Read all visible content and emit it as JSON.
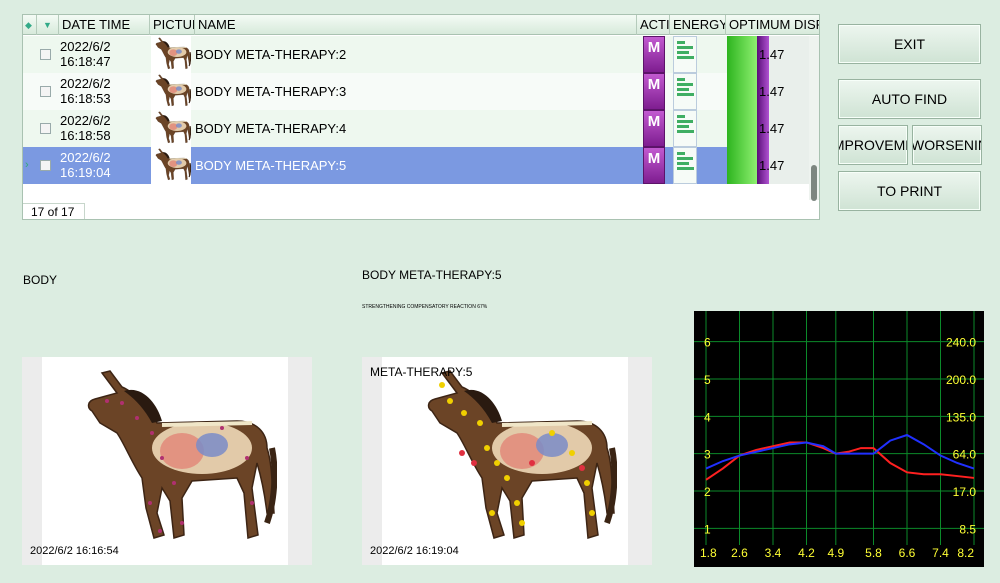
{
  "grid": {
    "headers": [
      "DATE TIME",
      "PICTUR",
      "NAME",
      "ACTIV",
      "ENERGY",
      "OPTIMUM DISPE"
    ],
    "rows": [
      {
        "date": "2022/6/2",
        "time": "16:18:47",
        "name": "BODY META-THERAPY:2",
        "badge": "M",
        "value": "1.47",
        "selected": false
      },
      {
        "date": "2022/6/2",
        "time": "16:18:53",
        "name": "BODY META-THERAPY:3",
        "badge": "M",
        "value": "1.47",
        "selected": false
      },
      {
        "date": "2022/6/2",
        "time": "16:18:58",
        "name": "BODY META-THERAPY:4",
        "badge": "M",
        "value": "1.47",
        "selected": false
      },
      {
        "date": "2022/6/2",
        "time": "16:19:04",
        "name": "BODY META-THERAPY:5",
        "badge": "M",
        "value": "1.47",
        "selected": true
      }
    ],
    "count": "17 of 17",
    "current_indicator": "›"
  },
  "buttons": {
    "exit": "EXIT",
    "auto_find": "AUTO FIND",
    "improvement": "IMPROVEMENT",
    "worsening": "WORSENING",
    "print": "TO PRINT"
  },
  "left_panel": {
    "label": "BODY",
    "timestamp": "2022/6/2 16:16:54"
  },
  "right_panel": {
    "title": "BODY META-THERAPY:5",
    "subtitle": "STRENGTHENING COMPENSATORY REACTION 67%",
    "caption": "META-THERAPY:5",
    "timestamp": "2022/6/2 16:19:04"
  },
  "chart_data": {
    "type": "line",
    "x_ticks": [
      "1.8",
      "2.6",
      "3.4",
      "4.2",
      "4.9",
      "5.8",
      "6.6",
      "7.4",
      "8.2"
    ],
    "left_ticks": [
      "6",
      "5",
      "4",
      "3",
      "2",
      "1"
    ],
    "right_ticks": [
      "240.0",
      "200.0",
      "135.0",
      "64.0",
      "17.0",
      "8.5"
    ],
    "ylim": [
      0.5,
      6.5
    ],
    "series": [
      {
        "color": "#ff2020",
        "x": [
          1.8,
          2.2,
          2.6,
          3.0,
          3.4,
          3.8,
          4.2,
          4.6,
          4.9,
          5.2,
          5.5,
          5.8,
          6.2,
          6.6,
          7.0,
          7.4,
          7.8,
          8.2
        ],
        "y": [
          2.3,
          2.6,
          2.95,
          3.1,
          3.2,
          3.3,
          3.3,
          3.15,
          3.0,
          3.05,
          3.15,
          3.15,
          2.75,
          2.5,
          2.45,
          2.45,
          2.4,
          2.35
        ]
      },
      {
        "color": "#2030ff",
        "x": [
          1.8,
          2.2,
          2.6,
          3.0,
          3.4,
          3.8,
          4.2,
          4.6,
          4.9,
          5.2,
          5.5,
          5.8,
          6.2,
          6.6,
          7.0,
          7.4,
          7.8,
          8.2
        ],
        "y": [
          2.6,
          2.8,
          2.95,
          3.05,
          3.15,
          3.25,
          3.3,
          3.2,
          3.0,
          3.0,
          3.0,
          3.0,
          3.35,
          3.5,
          3.25,
          2.95,
          2.75,
          2.6
        ]
      }
    ],
    "grid_color": "#0b8a2a",
    "tick_color": "#ffff33"
  },
  "colors": {
    "background": "#dcede1",
    "selected_row": "#7b99e1",
    "row_alt": "#eef8ef"
  }
}
